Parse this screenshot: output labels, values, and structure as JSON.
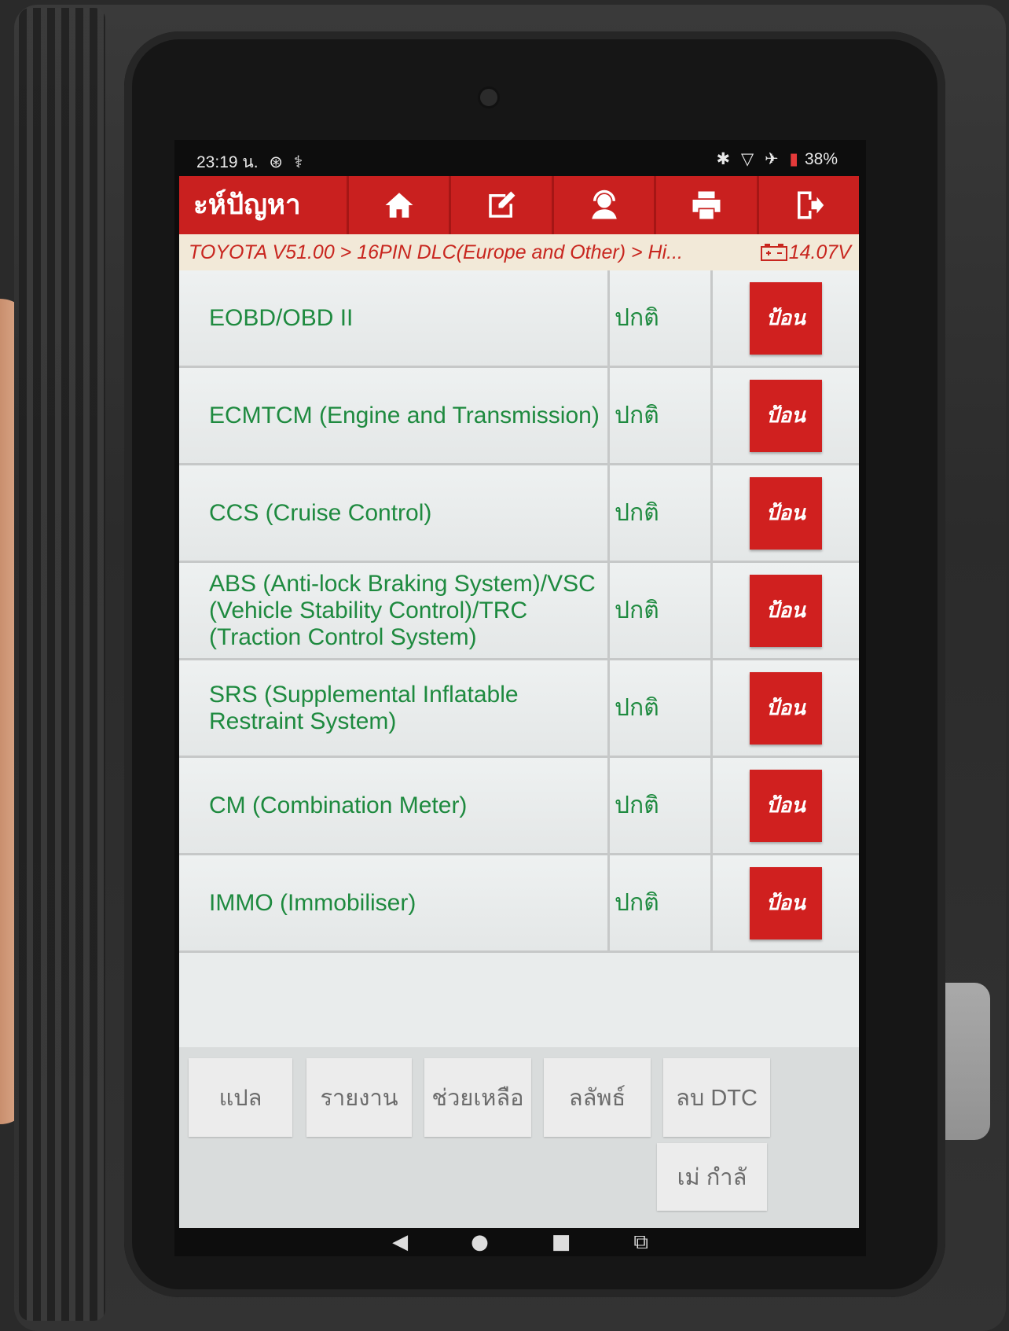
{
  "status_bar": {
    "time": "23:19 น.",
    "battery": "38%"
  },
  "toolbar": {
    "title": "ะห์ปัญหา",
    "icons": [
      "home-icon",
      "edit-icon",
      "support-icon",
      "print-icon",
      "exit-icon"
    ]
  },
  "breadcrumb": {
    "path": "TOYOTA V51.00 > 16PIN DLC(Europe and Other) > Hi...",
    "voltage": "14.07V"
  },
  "systems": [
    {
      "name": "EOBD/OBD II",
      "status": "ปกติ",
      "action": "ป้อน"
    },
    {
      "name": "ECMTCM (Engine and Transmission)",
      "status": "ปกติ",
      "action": "ป้อน"
    },
    {
      "name": "CCS (Cruise Control)",
      "status": "ปกติ",
      "action": "ป้อน"
    },
    {
      "name": "ABS (Anti-lock Braking System)/VSC (Vehicle Stability Control)/TRC (Traction Control System)",
      "status": "ปกติ",
      "action": "ป้อน"
    },
    {
      "name": "SRS (Supplemental Inflatable Restraint System)",
      "status": "ปกติ",
      "action": "ป้อน"
    },
    {
      "name": "CM (Combination Meter)",
      "status": "ปกติ",
      "action": "ป้อน"
    },
    {
      "name": "IMMO (Immobiliser)",
      "status": "ปกติ",
      "action": "ป้อน"
    }
  ],
  "bottom_buttons": {
    "translate": "แปล",
    "report": "รายงาน",
    "help": "ช่วยเหลือ",
    "result": "ลลัพธ์",
    "clear_dtc": "ลบ DTC",
    "extra": "เม่     กำลั"
  },
  "colors": {
    "accent_red": "#c9201f",
    "text_green": "#1e8a3f",
    "breadcrumb_red": "#c8261f"
  }
}
